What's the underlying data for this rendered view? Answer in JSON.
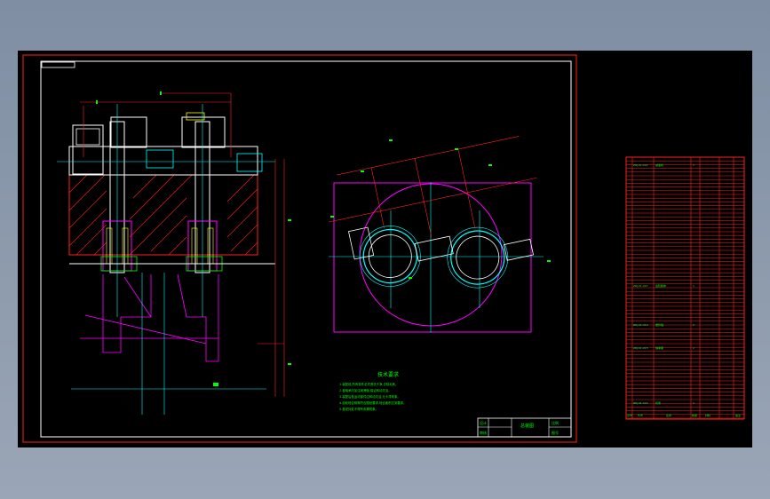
{
  "colors": {
    "background": "#8d99ab",
    "canvas": "#000000",
    "frame": "#ff2020",
    "paper_border": "#ffffff",
    "dimension": "#00ff00",
    "center_line": "#00ffff",
    "outline": "#ffffff",
    "construction": "#ff00ff",
    "hatch": "#ff2020",
    "accent": "#ffff00"
  },
  "icons": [
    "gear-icon",
    "shaft-icon",
    "bearing-icon"
  ],
  "title_block": {
    "title": "总装图",
    "left_top": "设计",
    "left_bottom": "审核",
    "right_top": "比例",
    "right_bottom": "图号"
  },
  "notes": {
    "heading": "技术要求",
    "lines": [
      "1.装配前,所有零件必须清洗干净,去除毛刺。",
      "2.各轴承内加注润滑脂,保证转动灵活。",
      "3.装配后各运动部件应转动灵活,无卡滞现象。",
      "4.齿轮啮合侧隙符合图纸要求,啮合面积达到要求。",
      "5.各密封处不得有渗漏现象。"
    ]
  },
  "parts_list": {
    "footer": [
      "序号",
      "代号",
      "名称",
      "数量",
      "材料",
      "备注"
    ],
    "highlighted_rows": [
      {
        "code": "ZRJ-01-001",
        "name": "减速机",
        "qty": "1"
      },
      {
        "code": "ZRJ-01-007",
        "name": "齿轮箱体",
        "qty": "1"
      },
      {
        "code": "ZRJ-01-012",
        "name": "搅拌轴",
        "qty": "2"
      },
      {
        "code": "ZRJ-01-015",
        "name": "轴承座",
        "qty": "2"
      },
      {
        "code": "ZRJ-01-021",
        "name": "机架",
        "qty": "1"
      }
    ]
  }
}
